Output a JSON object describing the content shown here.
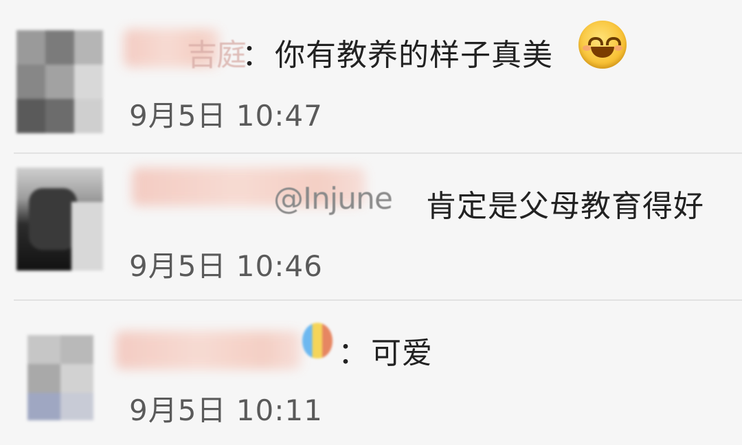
{
  "comments": [
    {
      "name_suffix": "吉庭",
      "separator": "：",
      "text": "你有教养的样子真美",
      "emoji": "smiling-face-emoji",
      "time": "9月5日 10:47"
    },
    {
      "mention": "@Injune",
      "text": "肯定是父母教育得好",
      "time": "9月5日 10:46"
    },
    {
      "emoji": "hot-air-balloon-emoji",
      "separator": "：",
      "text": "可爱",
      "time": "9月5日 10:11"
    }
  ]
}
